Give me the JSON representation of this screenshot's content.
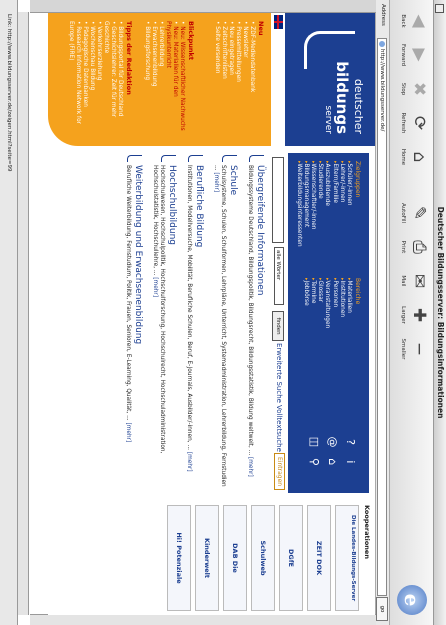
{
  "window": {
    "title": "Deutscher Bildungsserver: Bildungsinformationen"
  },
  "toolbar": {
    "buttons": [
      {
        "label": "Back",
        "icon": "back-arrow-icon",
        "dim": true
      },
      {
        "label": "Forward",
        "icon": "forward-arrow-icon",
        "dim": true
      },
      {
        "label": "Stop",
        "icon": "stop-icon",
        "dim": true
      },
      {
        "label": "Refresh",
        "icon": "refresh-icon",
        "dim": false
      },
      {
        "label": "Home",
        "icon": "home-icon",
        "dim": false
      },
      {
        "label": "AutoFill",
        "icon": "autofill-icon",
        "dim": false
      },
      {
        "label": "Print",
        "icon": "print-icon",
        "dim": false
      },
      {
        "label": "Mail",
        "icon": "mail-icon",
        "dim": false
      },
      {
        "label": "Larger",
        "icon": "larger-text-icon",
        "dim": false
      },
      {
        "label": "Smaller",
        "icon": "smaller-text-icon",
        "dim": false
      }
    ]
  },
  "address": {
    "label": "Address",
    "url": "http://www.bildungsserver.de/",
    "go": "go"
  },
  "status": {
    "text": "Link: http://www.bildungsserver.de/zeigen.html?seite=99"
  },
  "logo": {
    "line1": "deutscher",
    "line2": "bildungs",
    "line3": "server"
  },
  "left_nav": {
    "sections": [
      {
        "title": "Neu",
        "items": [
          {
            "label": "ZDF-Mediendatenbank"
          },
          {
            "label": "Newsletter"
          },
          {
            "label": "Pressemitteilungen"
          },
          {
            "label": "Neu eingetragen"
          },
          {
            "label": "Zeitschriftenlisten"
          },
          {
            "label": "Seite versenden"
          }
        ]
      },
      {
        "title": "Blickpunkt",
        "items": [
          {
            "label": "Neu: Wissenschaftlicher Nachwuchs",
            "red": true
          },
          {
            "label": "Neu: Materialien für den Physikunterricht",
            "red": true
          },
          {
            "label": "Lehrerbildung"
          },
          {
            "label": "Erwachsenenbildung"
          },
          {
            "label": "Bildungsforschung"
          }
        ]
      },
      {
        "title": "Tipps der Redaktion",
        "items": [
          {
            "label": "Bildungsportal für Deutschland"
          },
          {
            "label": "Geschichtslehrer: Zeit für mehr Geschichte"
          },
          {
            "label": "Verkehrserziehung"
          },
          {
            "label": "Wochenschau Bildung"
          },
          {
            "label": "Pädagogische Datenbanken"
          },
          {
            "label": "Research information Network for Europe (FIRE)"
          }
        ]
      }
    ]
  },
  "navbar": {
    "col1": {
      "header": "Zielgruppen",
      "items": [
        "Schüler/-innen",
        "Lehrer/-innen",
        "Eltern/Familie",
        "Auszubildende",
        "Studierende",
        "Wissenschaftler/-innen",
        "Bildungsmanagement",
        "Weiterbildungsinteressenten"
      ]
    },
    "col2": {
      "header": "Bereiche",
      "items": [
        "Materialien",
        "Institutionen",
        "Personen",
        "Veranstaltungen",
        "Glossar",
        "Termine",
        "Jobbörse"
      ]
    }
  },
  "search": {
    "select_value": "alle Wörter",
    "button": "finden",
    "link_advanced": "Erweiterte Suche",
    "link_fulltext": "Volltextsuche",
    "link_register": "Eintragen"
  },
  "topics": [
    {
      "title": "Übergreifende Informationen",
      "desc": "Bildungssysteme Deutschland, Bildungspolitik, Bildungsrecht, Bildungsstatistik, Bildung weltweit, ...",
      "more": "[mehr]"
    },
    {
      "title": "Schule",
      "desc": "Schulsysteme, Schulen, Schulformen, Lehrpläne, Unterricht, Systemadministration, Lehrerbildung, Fernstudien ...",
      "more": "[mehr]"
    },
    {
      "title": "Berufliche Bildung",
      "desc": "Institutionen, Modellversuche, Mobilität, Berufliche Schulen, Beruf, E-Journals, Ausbilder/-innen, ...",
      "more": "[mehr]"
    },
    {
      "title": "Hochschulbildung",
      "desc": "Hochschulwesen, Hochschulpolitik, Hochschulforschung, Hochschulrecht, Hochschuladministration, Hochschulstatistik, Hochschullehre, ...",
      "more": "[mehr]"
    },
    {
      "title": "Weiterbildung und Erwachsenenbildung",
      "desc": "Berufliche Weiterbildung, Fernstudium, Politik, Frauen, Senioren, E-Learning, Qualität, ...",
      "more": "[mehr]"
    }
  ],
  "cooperations": {
    "header": "Kooperationen",
    "partners": [
      {
        "label": "Die Landes-Bildungs-Server"
      },
      {
        "label": "ZEIT DOK"
      },
      {
        "label": "DGfE"
      },
      {
        "label": "Schulweb"
      },
      {
        "label": "DAB Die"
      },
      {
        "label": "Kinderwelt"
      },
      {
        "label": "Hi! Potenziale"
      }
    ]
  }
}
